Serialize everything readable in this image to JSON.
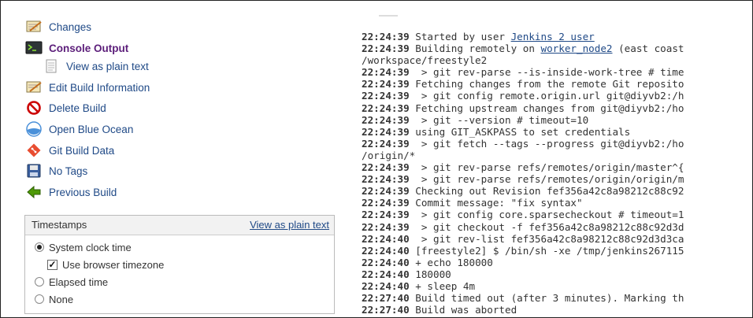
{
  "sidebar": {
    "items": [
      {
        "label": "Changes",
        "icon": "notepad-icon"
      },
      {
        "label": "Console Output",
        "icon": "terminal-icon"
      },
      {
        "label": "View as plain text",
        "icon": "document-icon"
      },
      {
        "label": "Edit Build Information",
        "icon": "notepad-edit-icon"
      },
      {
        "label": "Delete Build",
        "icon": "no-entry-icon"
      },
      {
        "label": "Open Blue Ocean",
        "icon": "blue-ocean-icon"
      },
      {
        "label": "Git Build Data",
        "icon": "git-icon"
      },
      {
        "label": "No Tags",
        "icon": "floppy-disk-icon"
      },
      {
        "label": "Previous Build",
        "icon": "green-left-arrow-icon"
      }
    ]
  },
  "timestamps": {
    "title": "Timestamps",
    "plain_link": "View as plain text",
    "options": {
      "system": "System clock time",
      "browser_tz": "Use browser timezone",
      "elapsed": "Elapsed time",
      "none": "None"
    },
    "selected": "system",
    "browser_tz_checked": true
  },
  "console": {
    "lines": [
      {
        "time": "22:24:39",
        "text": "Started by user ",
        "link": "Jenkins 2 user",
        "after": ""
      },
      {
        "time": "22:24:39",
        "text": "Building remotely on ",
        "link": "worker_node2",
        "after": " (east coast"
      },
      {
        "time": "",
        "text": "/workspace/freestyle2"
      },
      {
        "time": "22:24:39",
        "text": " > git rev-parse --is-inside-work-tree # time"
      },
      {
        "time": "22:24:39",
        "text": "Fetching changes from the remote Git reposito"
      },
      {
        "time": "22:24:39",
        "text": " > git config remote.origin.url git@diyvb2:/h"
      },
      {
        "time": "22:24:39",
        "text": "Fetching upstream changes from git@diyvb2:/ho"
      },
      {
        "time": "22:24:39",
        "text": " > git --version # timeout=10"
      },
      {
        "time": "22:24:39",
        "text": "using GIT_ASKPASS to set credentials"
      },
      {
        "time": "22:24:39",
        "text": " > git fetch --tags --progress git@diyvb2:/ho"
      },
      {
        "time": "",
        "text": "/origin/*"
      },
      {
        "time": "22:24:39",
        "text": " > git rev-parse refs/remotes/origin/master^{"
      },
      {
        "time": "22:24:39",
        "text": " > git rev-parse refs/remotes/origin/origin/m"
      },
      {
        "time": "22:24:39",
        "text": "Checking out Revision fef356a42c8a98212c88c92"
      },
      {
        "time": "22:24:39",
        "text": "Commit message: \"fix syntax\""
      },
      {
        "time": "22:24:39",
        "text": " > git config core.sparsecheckout # timeout=1"
      },
      {
        "time": "22:24:39",
        "text": " > git checkout -f fef356a42c8a98212c88c92d3d"
      },
      {
        "time": "22:24:40",
        "text": " > git rev-list fef356a42c8a98212c88c92d3d3ca"
      },
      {
        "time": "22:24:40",
        "text": "[freestyle2] $ /bin/sh -xe /tmp/jenkins267115"
      },
      {
        "time": "22:24:40",
        "text": "+ echo 180000"
      },
      {
        "time": "22:24:40",
        "text": "180000"
      },
      {
        "time": "22:24:40",
        "text": "+ sleep 4m"
      },
      {
        "time": "22:27:40",
        "text": "Build timed out (after 3 minutes). Marking th"
      },
      {
        "time": "22:27:40",
        "text": "Build was aborted"
      }
    ]
  }
}
